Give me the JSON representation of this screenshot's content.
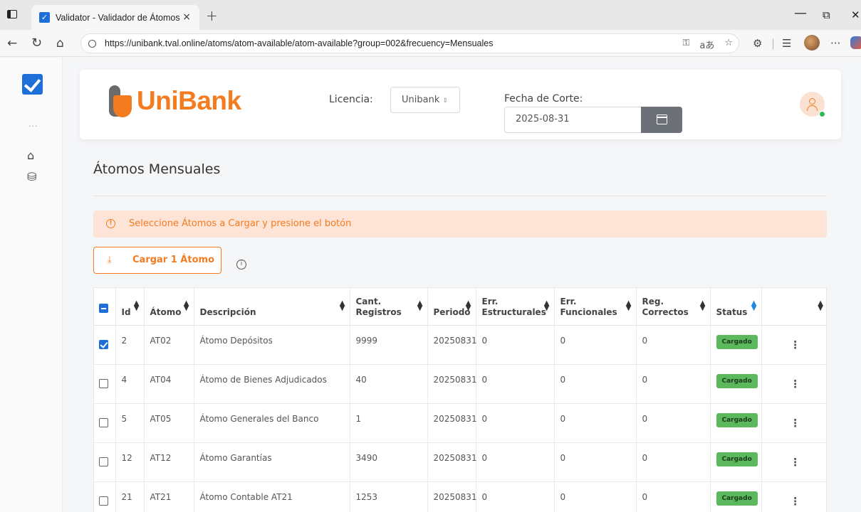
{
  "browser": {
    "tab_title": "Validator - Validador de Átomos",
    "tab_close": "×",
    "new_tab": "+",
    "url": "https://unibank.tval.online/atoms/atom-available/atom-available?group=002&frecuency=Mensuales",
    "window_controls": {
      "minimize": "—",
      "maximize": "⧉",
      "close": "✕"
    }
  },
  "rail": {
    "dots": "···"
  },
  "header": {
    "brand": "UniBank",
    "licencia_label": "Licencia:",
    "licencia_value": "Unibank",
    "fecha_label": "Fecha de Corte:",
    "fecha_value": "2025-08-31"
  },
  "page": {
    "title": "Átomos Mensuales",
    "alert_text": "Seleccione Átomos a Cargar y presione el botón",
    "load_button": "Cargar 1 Átomo"
  },
  "table": {
    "columns": [
      "Id",
      "Átomo",
      "Descripción",
      "Cant. Registros",
      "Periodo",
      "Err. Estructurales",
      "Err. Funcionales",
      "Reg. Correctos",
      "Status"
    ],
    "rows": [
      {
        "checked": true,
        "id": "2",
        "atomo": "AT02",
        "descripcion": "Átomo Depósitos",
        "cant": "9999",
        "periodo": "20250831",
        "err_est": "0",
        "err_fun": "0",
        "reg_cor": "0",
        "status": "Cargado"
      },
      {
        "checked": false,
        "id": "4",
        "atomo": "AT04",
        "descripcion": "Átomo de Bienes Adjudicados",
        "cant": "40",
        "periodo": "20250831",
        "err_est": "0",
        "err_fun": "0",
        "reg_cor": "0",
        "status": "Cargado"
      },
      {
        "checked": false,
        "id": "5",
        "atomo": "AT05",
        "descripcion": "Átomo Generales del Banco",
        "cant": "1",
        "periodo": "20250831",
        "err_est": "0",
        "err_fun": "0",
        "reg_cor": "0",
        "status": "Cargado"
      },
      {
        "checked": false,
        "id": "12",
        "atomo": "AT12",
        "descripcion": "Átomo Garantías",
        "cant": "3490",
        "periodo": "20250831",
        "err_est": "0",
        "err_fun": "0",
        "reg_cor": "0",
        "status": "Cargado"
      },
      {
        "checked": false,
        "id": "21",
        "atomo": "AT21",
        "descripcion": "Átomo Contable AT21",
        "cant": "1253",
        "periodo": "20250831",
        "err_est": "0",
        "err_fun": "0",
        "reg_cor": "0",
        "status": "Cargado"
      }
    ]
  },
  "colors": {
    "brand_orange": "#f47b20",
    "brand_blue": "#1e6fd9",
    "status_green": "#5cb85c",
    "alert_bg": "#fde4d6"
  }
}
